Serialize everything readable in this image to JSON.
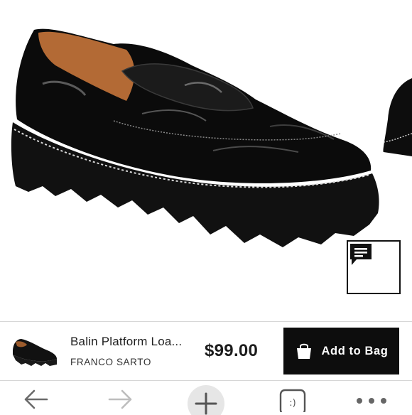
{
  "product": {
    "name": "Balin Platform Loa...",
    "brand": "FRANCO SARTO",
    "price": "$99.00"
  },
  "actions": {
    "add_to_bag_label": "Add to Bag"
  },
  "icons": {
    "chat": "chat-bubble-icon",
    "bag": "shopping-bag-icon",
    "back": "arrow-left-icon",
    "forward": "arrow-right-icon",
    "new_tab": "plus-icon",
    "tabs": "tab-switcher-icon",
    "menu": "more-horizontal-icon"
  },
  "colors": {
    "button_bg": "#0d0d0d",
    "text_primary": "#1f1f1f",
    "divider": "#d6d6d6"
  }
}
